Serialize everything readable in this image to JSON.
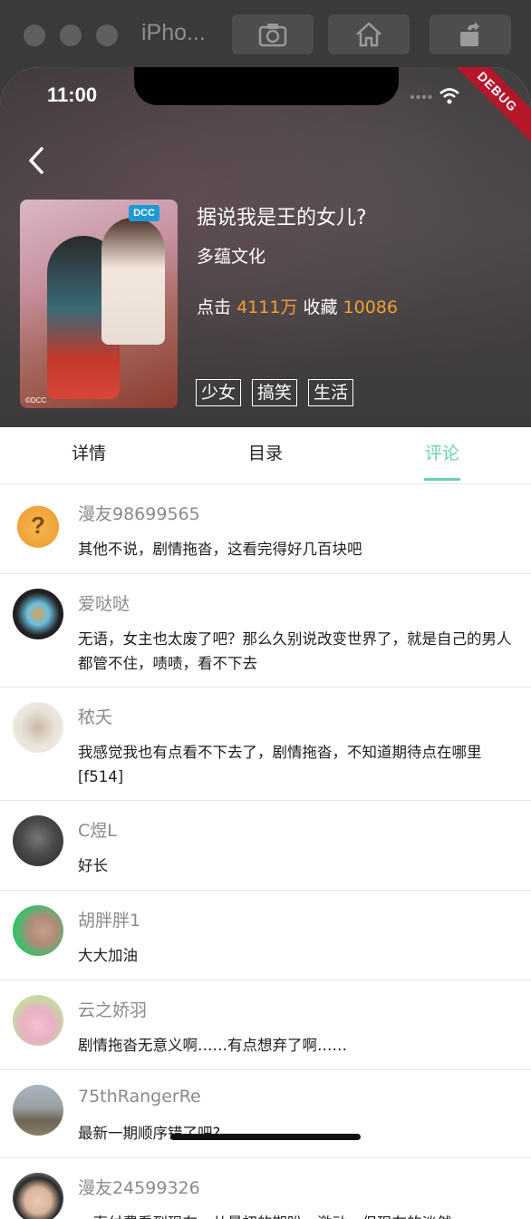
{
  "simulator": {
    "title": "iPho..."
  },
  "status_bar": {
    "time": "11:00",
    "debug_label": "DEBUG"
  },
  "comic": {
    "title": "据说我是王的女儿?",
    "author": "多蕴文化",
    "clicks_label": "点击",
    "clicks_value": "4111万",
    "favorites_label": "收藏",
    "favorites_value": "10086",
    "tags": [
      "少女",
      "搞笑",
      "生活"
    ],
    "cover_logo": "DCC",
    "cover_copyright": "©DCC"
  },
  "tabs": [
    {
      "label": "详情"
    },
    {
      "label": "目录"
    },
    {
      "label": "评论",
      "active": true
    }
  ],
  "comments": [
    {
      "user": "漫友98699565",
      "text": "其他不说，剧情拖沓，这看完得好几百块吧"
    },
    {
      "user": "爱哒哒",
      "text": "无语，女主也太废了吧？那么久别说改变世界了，就是自己的男人都管不住，啧啧，看不下去"
    },
    {
      "user": "秾夭",
      "text": "我感觉我也有点看不下去了，剧情拖沓，不知道期待点在哪里[f514]"
    },
    {
      "user": "C煜L",
      "text": "好长"
    },
    {
      "user": "胡胖胖1",
      "text": "大大加油"
    },
    {
      "user": "云之娇羽",
      "text": "剧情拖沓无意义啊……有点想弃了啊……"
    },
    {
      "user": "75thRangerRe",
      "text": "最新一期顺序错了吧?"
    },
    {
      "user": "漫友24599326",
      "text": "一直付费看到现在，从最初的期盼，激动，但现在的淡然"
    }
  ],
  "colors": {
    "accent_green": "#6ad3a8",
    "highlight_orange": "#f0a030"
  }
}
